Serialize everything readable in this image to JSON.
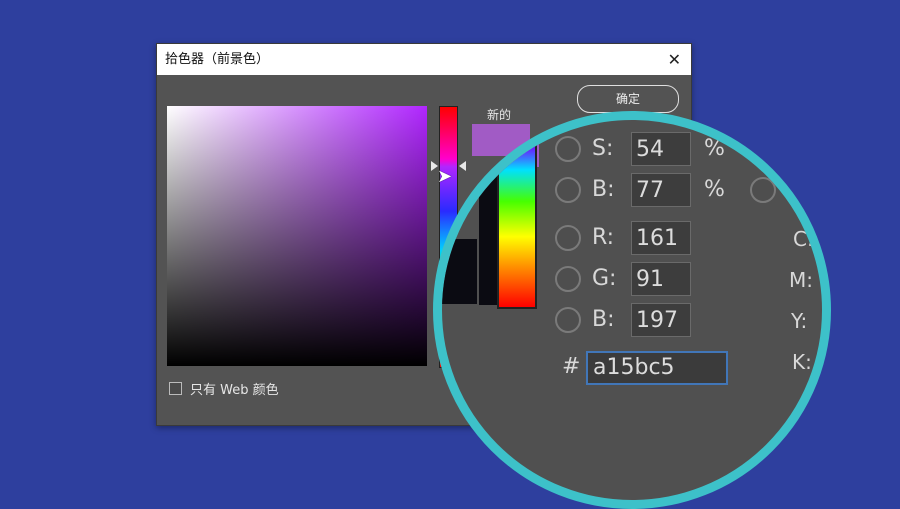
{
  "window": {
    "title": "拾色器（前景色）",
    "close_glyph": "✕"
  },
  "buttons": {
    "ok_label": "确定"
  },
  "preview": {
    "new_label": "新的",
    "new_color": "#a15bc5"
  },
  "options": {
    "web_only_label": "只有 Web 颜色"
  },
  "fields": {
    "s": {
      "label": "S:",
      "value": "54",
      "unit": "%"
    },
    "b": {
      "label": "B:",
      "value": "77",
      "unit": "%"
    },
    "r": {
      "label": "R:",
      "value": "161"
    },
    "g": {
      "label": "G:",
      "value": "91"
    },
    "blue": {
      "label": "B:",
      "value": "197"
    },
    "hex": {
      "label": "#",
      "value": "a15bc5"
    }
  },
  "cmyk": {
    "c_label": "C:",
    "m_label": "M:",
    "y_label": "Y:",
    "k_label": "K:"
  },
  "colors": {
    "background": "#2e3f9e",
    "lens_border": "#3dc1c9",
    "hex_focus": "#4176b8"
  },
  "icons": {
    "close": "close-icon",
    "cursor": "pointer-cursor-icon"
  }
}
